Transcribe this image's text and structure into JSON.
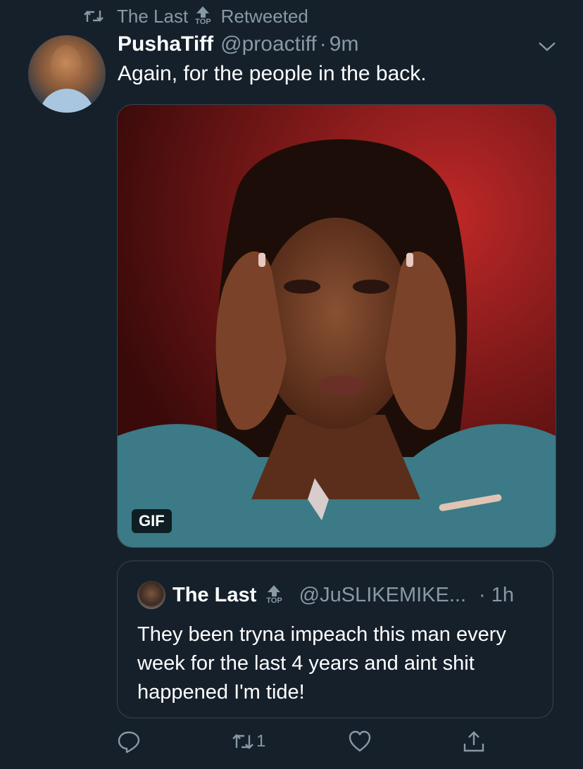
{
  "retweet_context": {
    "retweeter_name": "The Last",
    "badge_text": "TOP",
    "action_label": "Retweeted"
  },
  "tweet": {
    "display_name": "PushaTiff",
    "handle": "@proactiff",
    "separator": "·",
    "time": "9m",
    "text": "Again, for the people in the back.",
    "media": {
      "badge": "GIF"
    }
  },
  "quoted_tweet": {
    "display_name": "The Last",
    "badge_text": "TOP",
    "handle": "@JuSLIKEMIKE...",
    "time": "· 1h",
    "text": "They been tryna impeach this man every week for the last 4 years and aint shit happened I'm tide!"
  },
  "actions": {
    "reply_icon": "reply-icon",
    "retweet_icon": "retweet-icon",
    "retweet_count": "1",
    "like_icon": "heart-icon",
    "share_icon": "share-icon"
  },
  "colors": {
    "background": "#15202b",
    "secondary_text": "#8899a6",
    "border": "#38444d"
  }
}
